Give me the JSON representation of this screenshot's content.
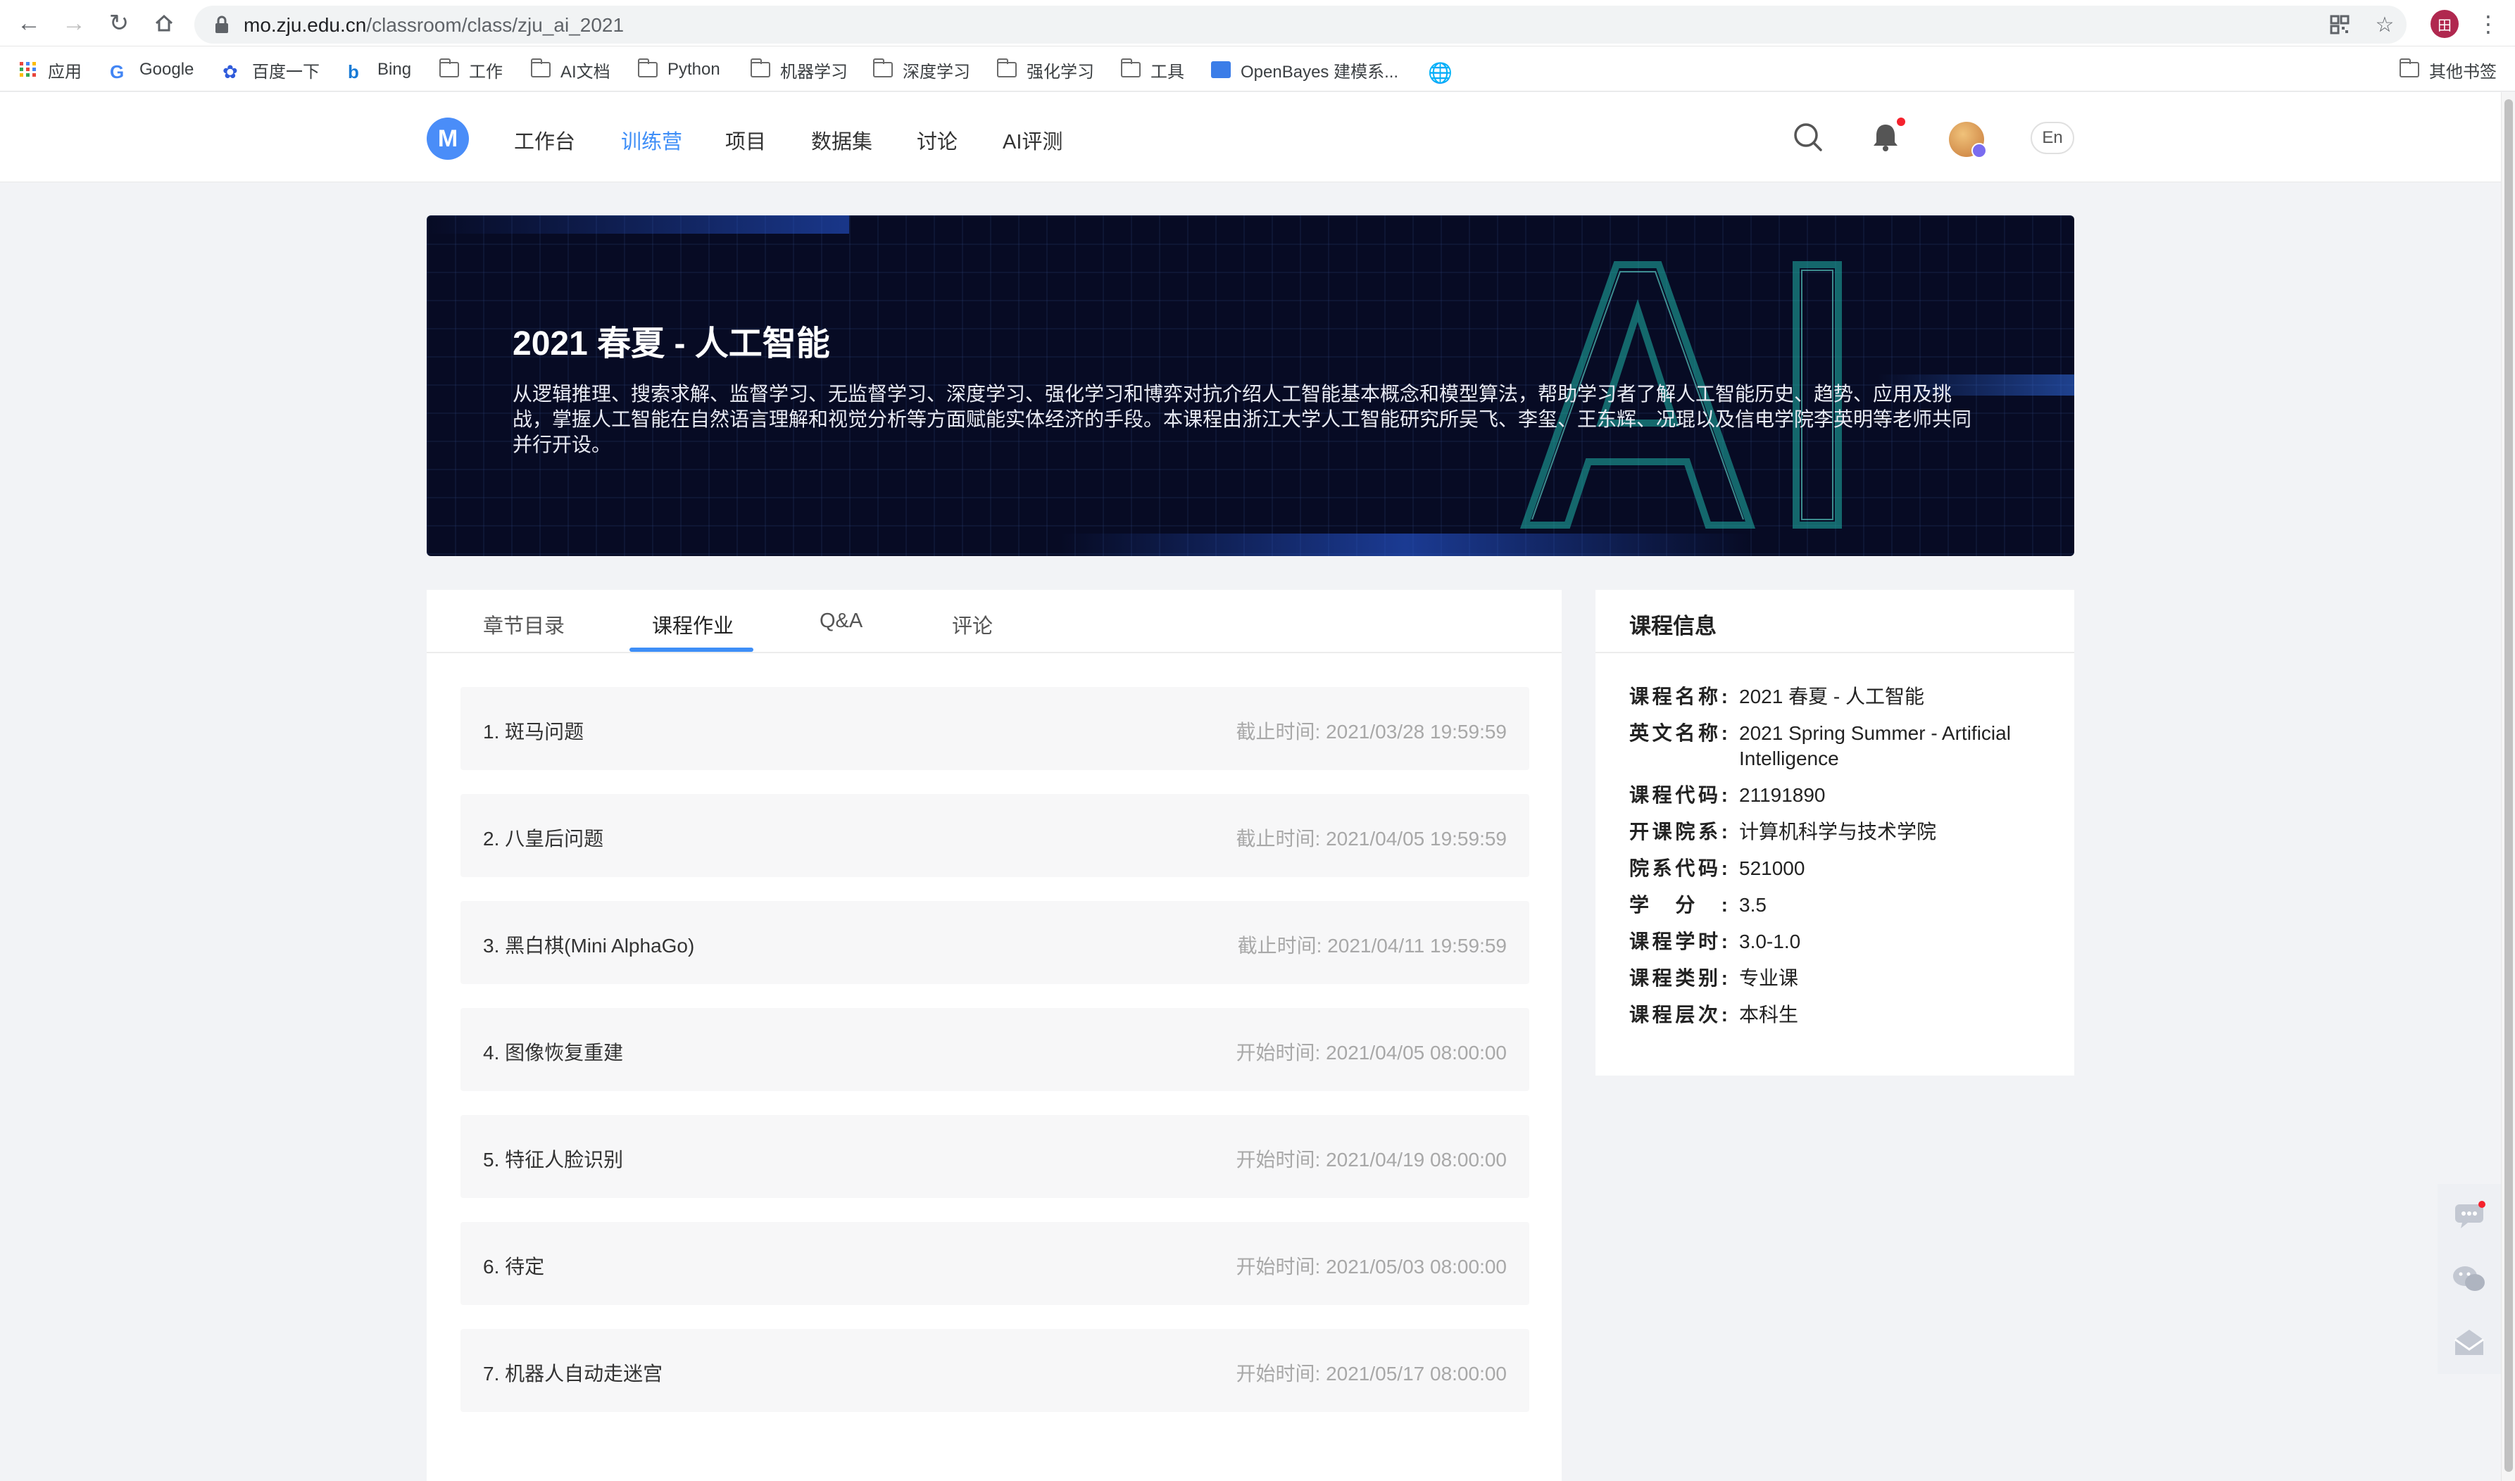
{
  "browser": {
    "url_host": "mo.zju.edu.cn",
    "url_path": "/classroom/class/zju_ai_2021",
    "profile_initial": "田",
    "bookmarks": [
      "应用",
      "Google",
      "百度一下",
      "Bing",
      "工作",
      "AI文档",
      "Python",
      "机器学习",
      "深度学习",
      "强化学习",
      "工具",
      "OpenBayes 建模系...",
      "其他书签"
    ]
  },
  "header": {
    "logo": "M",
    "nav": [
      "工作台",
      "训练营",
      "项目",
      "数据集",
      "讨论",
      "AI评测"
    ],
    "active_nav": "训练营",
    "lang": "En"
  },
  "banner": {
    "title": "2021 春夏 - 人工智能",
    "description": "从逻辑推理、搜索求解、监督学习、无监督学习、深度学习、强化学习和博弈对抗介绍人工智能基本概念和模型算法，帮助学习者了解人工智能历史、趋势、应用及挑战，掌握人工智能在自然语言理解和视觉分析等方面赋能实体经济的手段。本课程由浙江大学人工智能研究所吴飞、李玺、王东辉、况琨以及信电学院李英明等老师共同并行开设。"
  },
  "tabs": [
    "章节目录",
    "课程作业",
    "Q&A",
    "评论"
  ],
  "active_tab": "课程作业",
  "assignments": [
    {
      "title": "1. 斑马问题",
      "time": "截止时间: 2021/03/28 19:59:59"
    },
    {
      "title": "2. 八皇后问题",
      "time": "截止时间: 2021/04/05 19:59:59"
    },
    {
      "title": "3. 黑白棋(Mini AlphaGo)",
      "time": "截止时间: 2021/04/11 19:59:59"
    },
    {
      "title": "4. 图像恢复重建",
      "time": "开始时间: 2021/04/05 08:00:00"
    },
    {
      "title": "5. 特征人脸识别",
      "time": "开始时间: 2021/04/19 08:00:00"
    },
    {
      "title": "6. 待定",
      "time": "开始时间: 2021/05/03 08:00:00"
    },
    {
      "title": "7. 机器人自动走迷宫",
      "time": "开始时间: 2021/05/17 08:00:00"
    }
  ],
  "course_info": {
    "title": "课程信息",
    "rows": [
      {
        "label": "课程名称:",
        "value": "2021 春夏 - 人工智能"
      },
      {
        "label": "英文名称:",
        "value": "2021 Spring Summer - Artificial Intelligence"
      },
      {
        "label": "课程代码:",
        "value": "21191890"
      },
      {
        "label": "开课院系:",
        "value": "计算机科学与技术学院"
      },
      {
        "label": "院系代码:",
        "value": "521000"
      },
      {
        "label": "学分:",
        "value": "3.5"
      },
      {
        "label": "课程学时:",
        "value": "3.0-1.0"
      },
      {
        "label": "课程类别:",
        "value": "专业课"
      },
      {
        "label": "课程层次:",
        "value": "本科生"
      }
    ]
  },
  "colors": {
    "accent": "#3e8ef7",
    "banner_bg": "#070b24",
    "page_bg": "#f2f3f6",
    "notification_dot": "#f5222d"
  }
}
